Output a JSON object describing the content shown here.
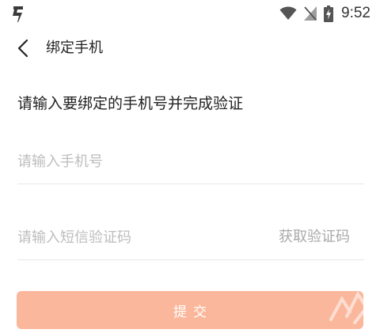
{
  "status_bar": {
    "time": "9:52",
    "icons": [
      "lightning-app-icon",
      "wifi-icon",
      "no-sim-icon",
      "battery-charging-icon"
    ]
  },
  "header": {
    "back_icon": "chevron-left-icon",
    "title": "绑定手机"
  },
  "main": {
    "instruction": "请输入要绑定的手机号并完成验证",
    "phone_input": {
      "value": "",
      "placeholder": "请输入手机号"
    },
    "code_input": {
      "value": "",
      "placeholder": "请输入短信验证码"
    },
    "get_code_label": "获取验证码",
    "submit_label": "提交"
  },
  "colors": {
    "accent": "#fbb79b",
    "placeholder": "#bdbdbd",
    "divider": "#e8e8e8",
    "secondary_text": "#a9a9a9"
  }
}
